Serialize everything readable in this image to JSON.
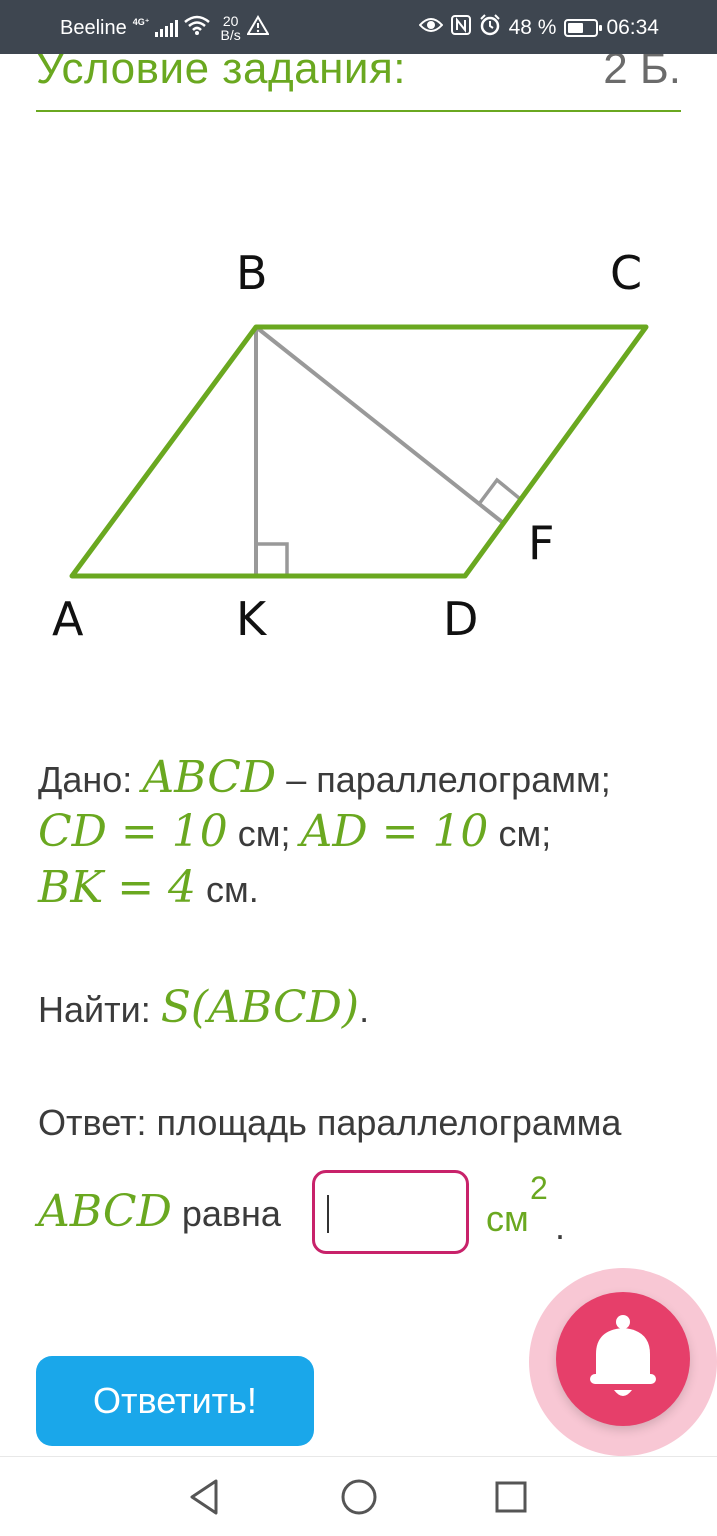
{
  "status_bar": {
    "carrier": "Beeline",
    "network_tag": "4G⁺",
    "speed_value": "20",
    "speed_unit": "B/s",
    "battery": "48 %",
    "time": "06:34"
  },
  "header": {
    "title": "Условие задания:",
    "points": "2 Б."
  },
  "figure": {
    "points": {
      "A": "A",
      "B": "B",
      "C": "C",
      "D": "D",
      "K": "K",
      "F": "F"
    }
  },
  "problem": {
    "given_label": "Дано: ",
    "given_math_1": "ABCD",
    "given_text_1": " – параллелограмм;",
    "cd_math": "CD = 10",
    "cd_unit": " см; ",
    "ad_math": "AD = 10",
    "ad_unit": " см;",
    "bk_math": "BK = 4",
    "bk_unit": " см.",
    "find_label": "Найти: ",
    "find_math": "S(ABCD)",
    "find_end": ".",
    "answer_text": "Ответ: площадь параллелограмма",
    "answer_math": "ABCD",
    "answer_equals": " равна",
    "answer_value": "",
    "unit": "см",
    "unit_power": "2",
    "answer_end": "."
  },
  "submit_label": "Ответить!",
  "colors": {
    "accent_green": "#6aa820",
    "input_border": "#c8226a",
    "submit_bg": "#1aa7ea",
    "bell_bg": "#e63f6a",
    "status_bg": "#3e4650"
  },
  "icons": {
    "signal": "signal-icon",
    "wifi": "wifi-icon",
    "warning": "warning-icon",
    "eye": "eye-icon",
    "nfc": "nfc-icon",
    "alarm": "alarm-icon",
    "battery": "battery-icon",
    "bell": "bell-icon",
    "back": "back-icon",
    "home": "home-icon",
    "recents": "recents-icon"
  }
}
